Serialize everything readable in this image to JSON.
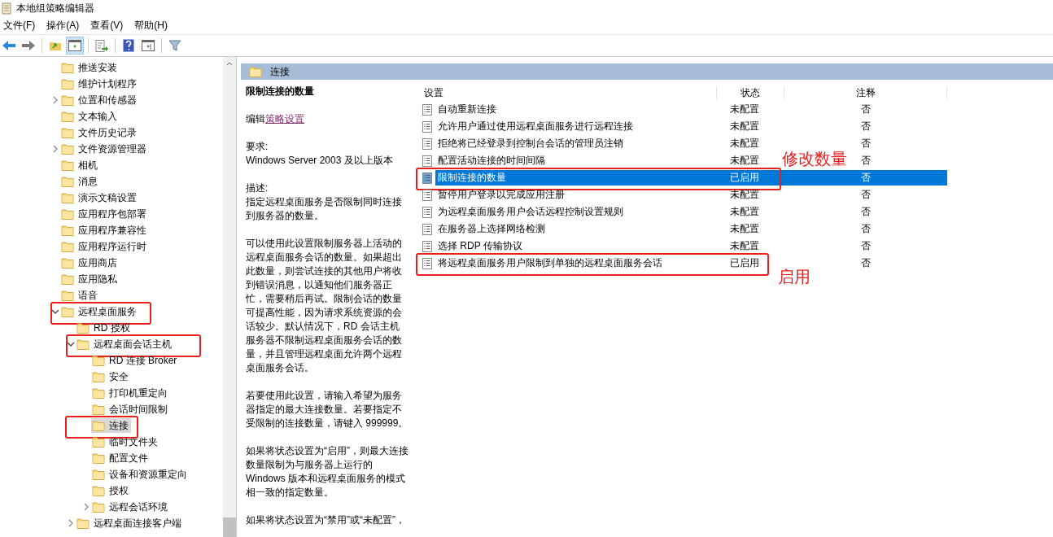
{
  "window": {
    "title": "本地组策略编辑器"
  },
  "menu": [
    "文件(F)",
    "操作(A)",
    "查看(V)",
    "帮助(H)"
  ],
  "toolbar": {
    "show_tree_pressed": true
  },
  "tree": [
    {
      "label": "推送安装",
      "kind": "leaf",
      "selected": false,
      "annotated": false
    },
    {
      "label": "维护计划程序",
      "kind": "leaf",
      "selected": false,
      "annotated": false
    },
    {
      "label": "位置和传感器",
      "kind": "collapsed",
      "selected": false,
      "annotated": false
    },
    {
      "label": "文本输入",
      "kind": "leaf",
      "selected": false,
      "annotated": false
    },
    {
      "label": "文件历史记录",
      "kind": "leaf",
      "selected": false,
      "annotated": false
    },
    {
      "label": "文件资源管理器",
      "kind": "collapsed",
      "selected": false,
      "annotated": false
    },
    {
      "label": "相机",
      "kind": "leaf",
      "selected": false,
      "annotated": false
    },
    {
      "label": "消息",
      "kind": "leaf",
      "selected": false,
      "annotated": false
    },
    {
      "label": "演示文稿设置",
      "kind": "leaf",
      "selected": false,
      "annotated": false
    },
    {
      "label": "应用程序包部署",
      "kind": "leaf",
      "selected": false,
      "annotated": false
    },
    {
      "label": "应用程序兼容性",
      "kind": "leaf",
      "selected": false,
      "annotated": false
    },
    {
      "label": "应用程序运行时",
      "kind": "leaf",
      "selected": false,
      "annotated": false
    },
    {
      "label": "应用商店",
      "kind": "leaf",
      "selected": false,
      "annotated": false
    },
    {
      "label": "应用隐私",
      "kind": "leaf",
      "selected": false,
      "annotated": false
    },
    {
      "label": "语音",
      "kind": "leaf",
      "selected": false,
      "annotated": false
    },
    {
      "label": "远程桌面服务",
      "kind": "expanded",
      "selected": false,
      "annotated": true,
      "children": [
        {
          "label": "RD 授权",
          "kind": "leaf",
          "selected": false,
          "annotated": false
        },
        {
          "label": "远程桌面会话主机",
          "kind": "expanded",
          "selected": false,
          "annotated": true,
          "children": [
            {
              "label": "RD 连接 Broker",
              "kind": "leaf",
              "selected": false,
              "annotated": false
            },
            {
              "label": "安全",
              "kind": "leaf",
              "selected": false,
              "annotated": false
            },
            {
              "label": "打印机重定向",
              "kind": "leaf",
              "selected": false,
              "annotated": false
            },
            {
              "label": "会话时间限制",
              "kind": "leaf",
              "selected": false,
              "annotated": false
            },
            {
              "label": "连接",
              "kind": "leaf",
              "selected": true,
              "annotated": true
            },
            {
              "label": "临时文件夹",
              "kind": "leaf",
              "selected": false,
              "annotated": false
            },
            {
              "label": "配置文件",
              "kind": "leaf",
              "selected": false,
              "annotated": false
            },
            {
              "label": "设备和资源重定向",
              "kind": "leaf",
              "selected": false,
              "annotated": false
            },
            {
              "label": "授权",
              "kind": "leaf",
              "selected": false,
              "annotated": false
            },
            {
              "label": "远程会话环境",
              "kind": "collapsed",
              "selected": false,
              "annotated": false
            }
          ]
        },
        {
          "label": "远程桌面连接客户端",
          "kind": "collapsed",
          "selected": false,
          "annotated": false
        }
      ]
    }
  ],
  "header": {
    "title": "连接"
  },
  "details": {
    "title": "限制连接的数量",
    "edit_prefix": "编辑",
    "edit_link": "策略设置",
    "requirements_label": "要求:",
    "requirements": "Windows Server 2003 及以上版本",
    "description_label": "描述:",
    "paragraphs": [
      "指定远程桌面服务是否限制同时连接到服务器的数量。",
      "可以使用此设置限制服务器上活动的远程桌面服务会话的数量。如果超出此数量，则尝试连接的其他用户将收到错误消息，以通知他们服务器正忙，需要稍后再试。限制会话的数量可提高性能，因为请求系统资源的会话较少。默认情况下，RD 会话主机服务器不限制远程桌面服务会话的数量，并且管理远程桌面允许两个远程桌面服务会话。",
      "若要使用此设置，请输入希望为服务器指定的最大连接数量。若要指定不受限制的连接数量，请键入 999999。",
      "如果将状态设置为“启用”，则最大连接数量限制为与服务器上运行的 Windows 版本和远程桌面服务的模式相一致的指定数量。",
      "如果将状态设置为“禁用”或“未配置”，"
    ]
  },
  "table": {
    "columns": [
      "设置",
      "状态",
      "注释"
    ],
    "rows": [
      {
        "setting": "自动重新连接",
        "state": "未配置",
        "comment": "否",
        "selected": false
      },
      {
        "setting": "允许用户通过使用远程桌面服务进行远程连接",
        "state": "未配置",
        "comment": "否",
        "selected": false
      },
      {
        "setting": "拒绝将已经登录到控制台会话的管理员注销",
        "state": "未配置",
        "comment": "否",
        "selected": false
      },
      {
        "setting": "配置活动连接的时间间隔",
        "state": "未配置",
        "comment": "否",
        "selected": false
      },
      {
        "setting": "限制连接的数量",
        "state": "已启用",
        "comment": "否",
        "selected": true,
        "note": "修改数量"
      },
      {
        "setting": "暂停用户登录以完成应用注册",
        "state": "未配置",
        "comment": "否",
        "selected": false
      },
      {
        "setting": "为远程桌面服务用户会话远程控制设置规则",
        "state": "未配置",
        "comment": "否",
        "selected": false
      },
      {
        "setting": "在服务器上选择网络检测",
        "state": "未配置",
        "comment": "否",
        "selected": false
      },
      {
        "setting": "选择 RDP 传输协议",
        "state": "未配置",
        "comment": "否",
        "selected": false
      },
      {
        "setting": "将远程桌面服务用户限制到单独的远程桌面服务会话",
        "state": "已启用",
        "comment": "否",
        "selected": false,
        "note": "启用"
      }
    ]
  }
}
